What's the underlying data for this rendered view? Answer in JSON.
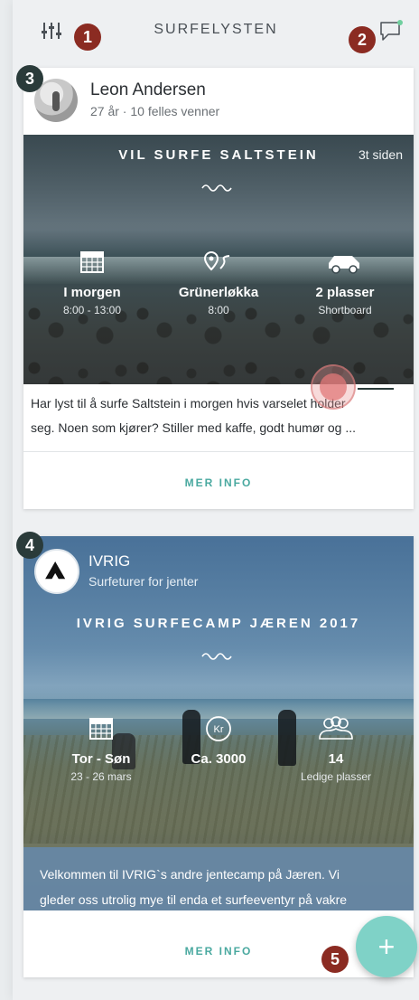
{
  "header": {
    "title": "SURFELYSTEN",
    "filter_icon": "sliders-icon",
    "chat_icon": "chat-bubble-icon"
  },
  "badges": [
    "1",
    "2",
    "3",
    "4",
    "5"
  ],
  "posts": [
    {
      "user_name": "Leon Andersen",
      "user_meta": "27 år  ·  10 felles venner",
      "title": "VIL SURFE SALTSTEIN",
      "time": "3t siden",
      "info": [
        {
          "icon": "calendar-icon",
          "main": "I morgen",
          "sub": "8:00 - 13:00"
        },
        {
          "icon": "route-pin-icon",
          "main": "Grünerløkka",
          "sub": "8:00"
        },
        {
          "icon": "car-icon",
          "main": "2 plasser",
          "sub": "Shortboard"
        }
      ],
      "description_line1": "Har lyst til å surfe Saltstein i morgen hvis varselet holder",
      "description_line2": "seg. Noen som kjører? Stiller med kaffe, godt humør og  ...",
      "more_info": "MER INFO"
    },
    {
      "org_name": "IVRIG",
      "org_sub": "Surfeturer for jenter",
      "title": "IVRIG SURFECAMP JÆREN 2017",
      "info": [
        {
          "icon": "calendar-icon",
          "main": "Tor - Søn",
          "sub": "23 - 26 mars"
        },
        {
          "icon": "kr-coin-icon",
          "main": "Ca. 3000",
          "sub": ""
        },
        {
          "icon": "group-icon",
          "main": "14",
          "sub": "Ledige plasser"
        }
      ],
      "description_line1": "Velkommen til IVRIG`s andre jentecamp på Jæren. Vi",
      "description_line2": "gleder oss utrolig mye til enda et surfeeventyr på vakre",
      "more_info": "MER INFO"
    }
  ],
  "fab": {
    "label": "+"
  },
  "colors": {
    "accent": "#4aa9a0",
    "fab": "#7fd2c7",
    "badge_red": "#8b2b22",
    "badge_dark": "#2a3b3a"
  }
}
